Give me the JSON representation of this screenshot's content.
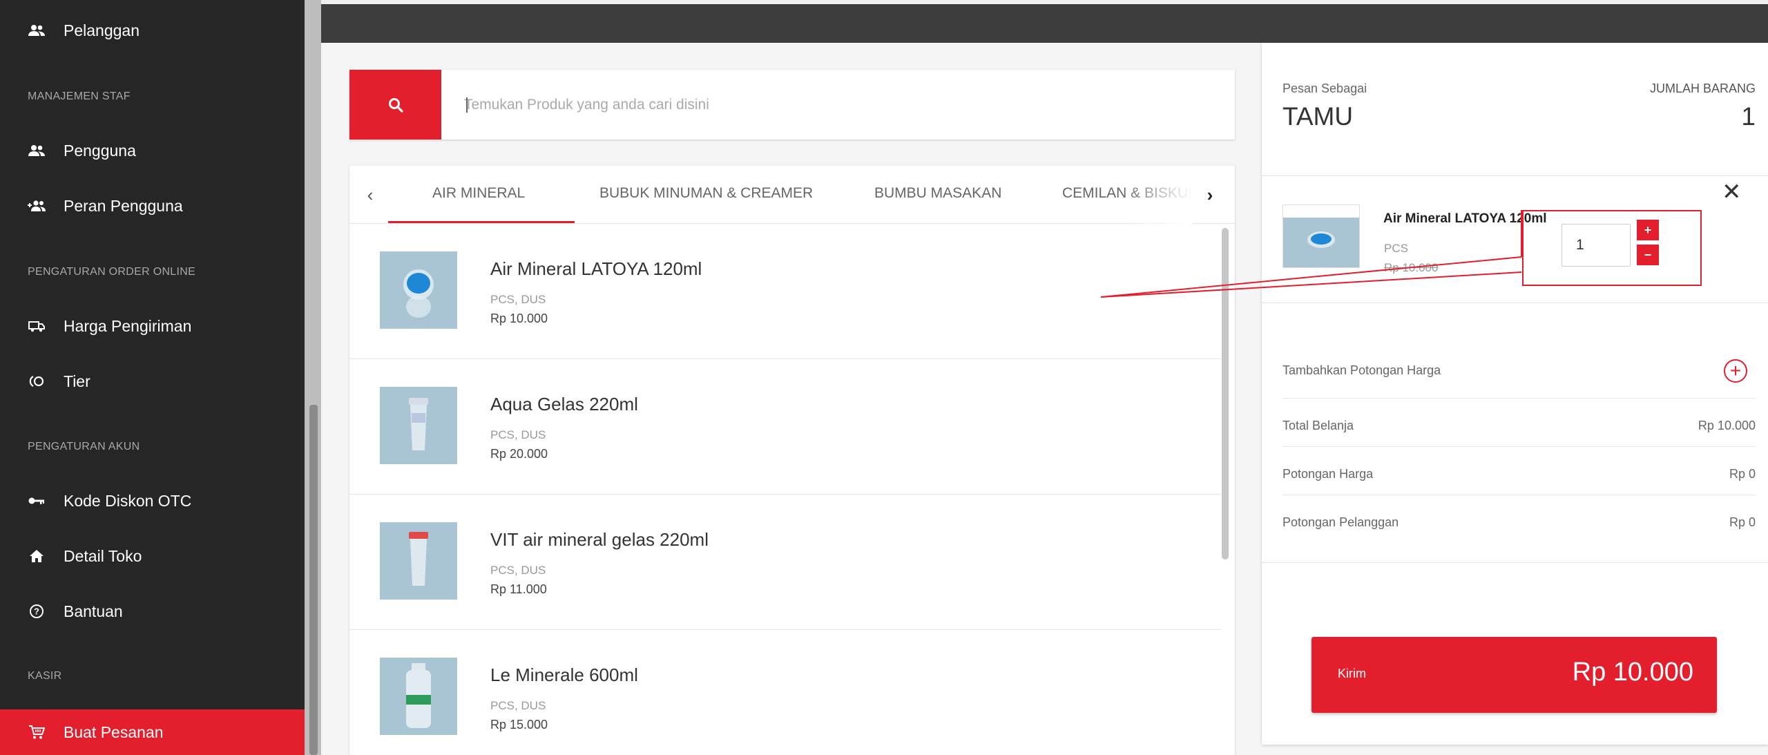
{
  "sidebar": {
    "items": [
      {
        "label": "Pelanggan",
        "icon": "users-icon"
      },
      {
        "header": "MANAJEMEN STAF"
      },
      {
        "label": "Pengguna",
        "icon": "users-icon"
      },
      {
        "label": "Peran Pengguna",
        "icon": "user-role-icon"
      },
      {
        "header": "PENGATURAN ORDER ONLINE"
      },
      {
        "label": "Harga Pengiriman",
        "icon": "truck-icon"
      },
      {
        "label": "Tier",
        "icon": "tier-icon"
      },
      {
        "header": "PENGATURAN AKUN"
      },
      {
        "label": "Kode Diskon OTC",
        "icon": "key-icon"
      },
      {
        "label": "Detail Toko",
        "icon": "home-icon"
      },
      {
        "label": "Bantuan",
        "icon": "help-icon"
      },
      {
        "header": "KASIR"
      },
      {
        "label": "Buat Pesanan",
        "icon": "cart-icon",
        "active": true
      }
    ]
  },
  "search": {
    "placeholder": "Temukan Produk yang anda cari disini"
  },
  "tabs": [
    "AIR MINERAL",
    "BUBUK MINUMAN & CREAMER",
    "BUMBU MASAKAN",
    "CEMILAN & BISKUI"
  ],
  "products": [
    {
      "name": "Air Mineral LATOYA 120ml",
      "units": "PCS, DUS",
      "price": "Rp 10.000"
    },
    {
      "name": "Aqua Gelas 220ml",
      "units": "PCS, DUS",
      "price": "Rp 20.000"
    },
    {
      "name": "VIT air mineral gelas 220ml",
      "units": "PCS, DUS",
      "price": "Rp 11.000"
    },
    {
      "name": "Le Minerale 600ml",
      "units": "PCS, DUS",
      "price": "Rp 15.000"
    }
  ],
  "order": {
    "order_as_label": "Pesan Sebagai",
    "order_as_value": "TAMU",
    "count_label": "JUMLAH BARANG",
    "count_value": "1",
    "cart": {
      "name": "Air Mineral LATOYA 120ml",
      "unit": "PCS",
      "price": "Rp 10.000",
      "qty": "1",
      "plus": "+",
      "minus": "−"
    },
    "add_discount_label": "Tambahkan Potongan Harga",
    "total_label": "Total Belanja",
    "total_value": "Rp 10.000",
    "discount_label": "Potongan Harga",
    "discount_value": "Rp 0",
    "customer_discount_label": "Potongan Pelanggan",
    "customer_discount_value": "Rp 0",
    "submit_label": "Kirim",
    "submit_amount": "Rp 10.000"
  },
  "colors": {
    "accent": "#e31e2d",
    "sidebar_bg": "#262626",
    "topbar_bg": "#3d3d3d"
  }
}
